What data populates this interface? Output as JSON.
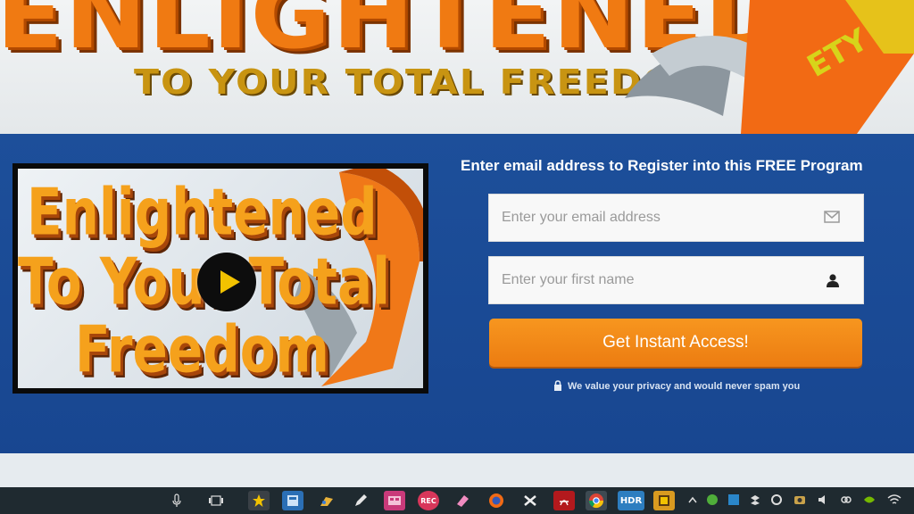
{
  "header": {
    "title": "ENLIGHTENED",
    "subtitle": "TO YOUR TOTAL FREEDOM",
    "badge": "ETY"
  },
  "video": {
    "title_lines": [
      "Enlightened",
      "To Your Total",
      "Freedom"
    ]
  },
  "form": {
    "heading": "Enter email address to Register into this FREE Program",
    "email_placeholder": "Enter your email address",
    "email_value": "",
    "name_placeholder": "Enter your first name",
    "name_value": "",
    "submit_label": "Get Instant Access!",
    "privacy_text": "We value your privacy and would never spam you"
  },
  "taskbar": {
    "items": [
      {
        "icon": "microphone-icon"
      },
      {
        "icon": "task-view-icon"
      },
      {
        "icon": "movie-star-app-icon"
      },
      {
        "icon": "calculator-app-icon"
      },
      {
        "icon": "paint-app-icon"
      },
      {
        "icon": "pen-app-icon"
      },
      {
        "icon": "video-editor-app-icon"
      },
      {
        "icon": "screen-recorder-app-icon",
        "label": "REC"
      },
      {
        "icon": "eraser-app-icon"
      },
      {
        "icon": "firefox-icon"
      },
      {
        "icon": "shuffle-app-icon"
      },
      {
        "icon": "pdf-reader-icon"
      },
      {
        "icon": "chrome-icon"
      },
      {
        "icon": "hdr-app-icon",
        "label": "HDR"
      },
      {
        "icon": "archive-app-icon"
      }
    ],
    "tray": [
      "chevron-up-icon",
      "security-icon",
      "network-icon",
      "dropbox-icon",
      "sync-icon",
      "camera-icon",
      "volume-icon",
      "link-icon",
      "nvidia-icon",
      "wifi-icon"
    ]
  },
  "colors": {
    "brand_orange": "#f07a12",
    "band_blue": "#1d4f9a",
    "cta_orange": "#f08a18"
  }
}
